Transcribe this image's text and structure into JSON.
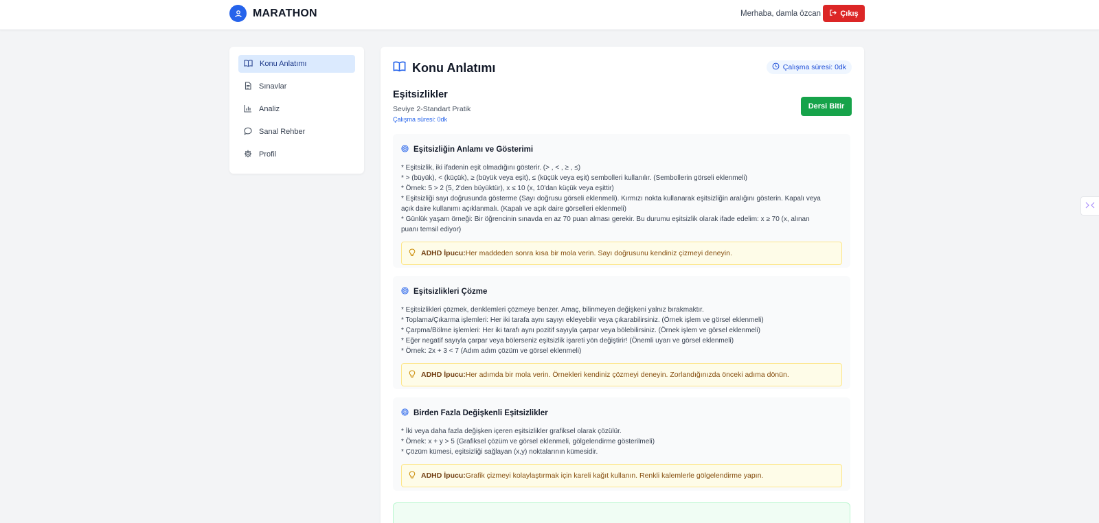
{
  "header": {
    "brand": "MARATHON",
    "greeting": "Merhaba, damla özcan",
    "logout_label": "Çıkış"
  },
  "sidebar": {
    "items": [
      {
        "label": "Konu Anlatımı",
        "icon": "book-icon",
        "active": true
      },
      {
        "label": "Sınavlar",
        "icon": "document-icon",
        "active": false
      },
      {
        "label": "Analiz",
        "icon": "bar-chart-icon",
        "active": false
      },
      {
        "label": "Sanal Rehber",
        "icon": "chat-bubble-icon",
        "active": false
      },
      {
        "label": "Profil",
        "icon": "gear-icon",
        "active": false
      }
    ]
  },
  "main": {
    "title": "Konu Anlatımı",
    "study_time_chip": "Çalışma süresi: 0dk",
    "lesson": {
      "title": "Eşitsizlikler",
      "level": "Seviye 2-Standart Pratik",
      "study_time": "Çalışma süresi: 0dk",
      "finish_label": "Dersi Bitir"
    },
    "sections": [
      {
        "title": "Eşitsizliğin Anlamı ve Gösterimi",
        "lines": [
          "* Eşitsizlik, iki ifadenin eşit olmadığını gösterir. (> , < , ≥ , ≤)",
          "* > (büyük), < (küçük), ≥ (büyük veya eşit), ≤ (küçük veya eşit) sembolleri kullanılır. (Sembollerin görseli eklenmeli)",
          "* Örnek: 5 > 2 (5, 2'den büyüktür), x ≤ 10 (x, 10'dan küçük veya eşittir)",
          "* Eşitsizliği sayı doğrusunda gösterme (Sayı doğrusu görseli eklenmeli). Kırmızı nokta kullanarak eşitsizliğin aralığını gösterin. Kapalı veya",
          "açık daire kullanımı açıklanmalı. (Kapalı ve açık daire görselleri eklenmeli)",
          "* Günlük yaşam örneği: Bir öğrencinin sınavda en az 70 puan alması gerekir. Bu durumu eşitsizlik olarak ifade edelim: x ≥ 70 (x, alınan",
          "puanı temsil ediyor)"
        ],
        "tip_label": "ADHD İpucu:",
        "tip_text": "Her maddeden sonra kısa bir mola verin. Sayı doğrusunu kendiniz çizmeyi deneyin."
      },
      {
        "title": "Eşitsizlikleri Çözme",
        "lines": [
          "* Eşitsizlikleri çözmek, denklemleri çözmeye benzer. Amaç, bilinmeyen değişkeni yalnız bırakmaktır.",
          "* Toplama/Çıkarma işlemleri: Her iki tarafa aynı sayıyı ekleyebilir veya çıkarabilirsiniz. (Örnek işlem ve görsel eklenmeli)",
          "* Çarpma/Bölme işlemleri: Her iki tarafı aynı pozitif sayıyla çarpar veya bölebilirsiniz. (Örnek işlem ve görsel eklenmeli)",
          "* Eğer negatif sayıyla çarpar veya bölerseniz eşitsizlik işareti yön değiştirir! (Önemli uyarı ve görsel eklenmeli)",
          "* Örnek: 2x + 3 < 7 (Adım adım çözüm ve görsel eklenmeli)"
        ],
        "tip_label": "ADHD İpucu:",
        "tip_text": "Her adımda bir mola verin. Örnekleri kendiniz çözmeyi deneyin. Zorlandığınızda önceki adıma dönün."
      },
      {
        "title": "Birden Fazla Değişkenli Eşitsizlikler",
        "lines": [
          "* İki veya daha fazla değişken içeren eşitsizlikler grafiksel olarak çözülür.",
          "* Örnek: x + y > 5 (Grafiksel çözüm ve görsel eklenmeli, gölgelendirme gösterilmeli)",
          "* Çözüm kümesi, eşitsizliği sağlayan (x,y) noktalarının kümesidir."
        ],
        "tip_label": "ADHD İpucu:",
        "tip_text": "Grafik çizmeyi kolaylaştırmak için kareli kağıt kullanın. Renkli kalemlerle gölgelendirme yapın."
      }
    ]
  },
  "colors": {
    "primary": "#2563eb",
    "danger": "#dc2626",
    "success": "#16a34a",
    "tip_bg": "#fefce8"
  }
}
